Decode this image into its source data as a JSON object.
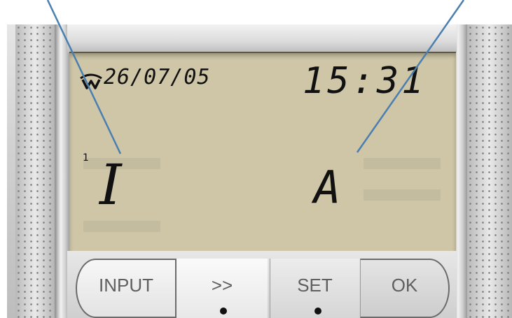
{
  "lcd": {
    "date": "26/07/05",
    "time": "15:31",
    "superscript": "1",
    "left_char": "I",
    "right_char": "A"
  },
  "buttons": {
    "input": "INPUT",
    "next": ">>",
    "set": "SET",
    "ok": "OK"
  },
  "icons": {
    "logo": "wifi-logo-icon"
  },
  "colors": {
    "lcd_background": "#cec6a6",
    "pointer_line": "#4a7fb0",
    "button_text": "#5f5f5f"
  }
}
